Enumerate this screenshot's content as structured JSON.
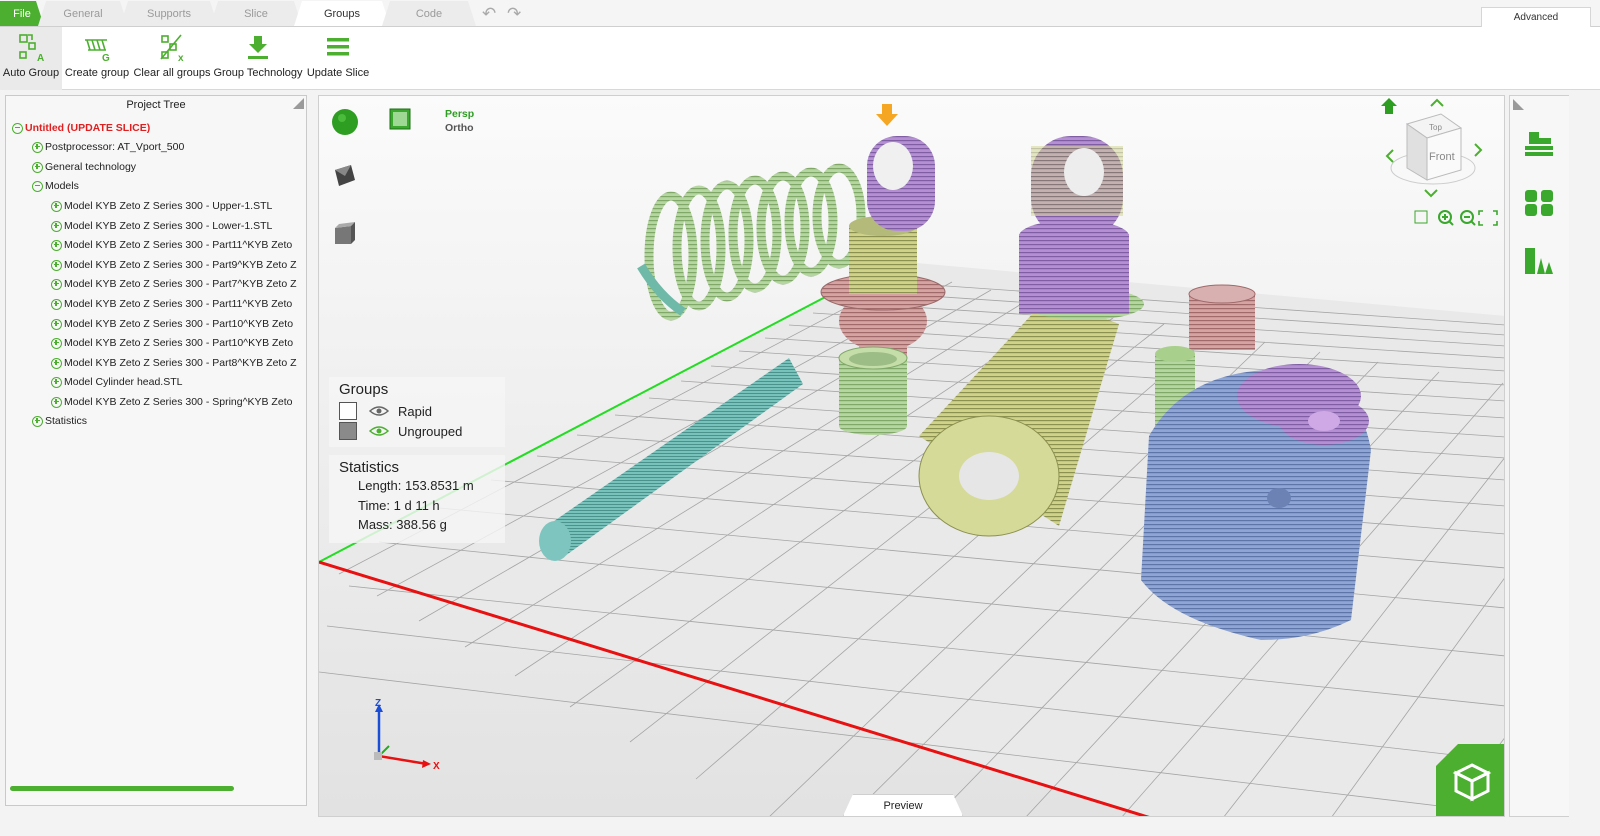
{
  "tabs": {
    "file": "File",
    "general": "General",
    "supports": "Supports",
    "slice": "Slice",
    "groups": "Groups",
    "code": "Code"
  },
  "advanced_label": "Advanced",
  "ribbon": {
    "auto_group": "Auto Group",
    "create_group": "Create group",
    "clear_groups": "Clear all groups",
    "group_technology": "Group Technology",
    "update_slice": "Update Slice"
  },
  "project_tree": {
    "header": "Project Tree",
    "root": "Untitled (UPDATE SLICE)",
    "postprocessor": "Postprocessor: AT_Vport_500",
    "general_technology": "General technology",
    "models": "Models",
    "model_items": [
      "Model KYB Zeto Z Series 300 - Upper-1.STL",
      "Model KYB Zeto Z Series 300 - Lower-1.STL",
      "Model KYB Zeto Z Series 300 - Part11^KYB Zeto",
      "Model KYB Zeto Z Series 300 - Part9^KYB Zeto Z",
      "Model KYB Zeto Z Series 300 - Part7^KYB Zeto Z",
      "Model KYB Zeto Z Series 300 - Part11^KYB Zeto",
      "Model KYB Zeto Z Series 300 - Part10^KYB Zeto",
      "Model KYB Zeto Z Series 300 - Part10^KYB Zeto",
      "Model KYB Zeto Z Series 300 - Part8^KYB Zeto Z",
      "Model Cylinder head.STL",
      "Model KYB Zeto Z Series 300 - Spring^KYB Zeto"
    ],
    "statistics": "Statistics"
  },
  "viewport": {
    "persp": "Persp",
    "ortho": "Ortho",
    "view_cube_top": "Top",
    "view_cube_front": "Front",
    "axis_z": "Z",
    "axis_x": "X",
    "preview_tab": "Preview"
  },
  "groups_panel": {
    "title": "Groups",
    "items": [
      "Rapid",
      "Ungrouped"
    ]
  },
  "statistics_panel": {
    "title": "Statistics",
    "length": "Length: 153.8531 m",
    "time": "Time: 1 d 11 h",
    "mass": "Mass: 388.56 g"
  },
  "colors": {
    "accent": "#4caf30",
    "root_node": "#e02020",
    "x_axis": "#e81010",
    "y_axis": "#22dd22"
  }
}
